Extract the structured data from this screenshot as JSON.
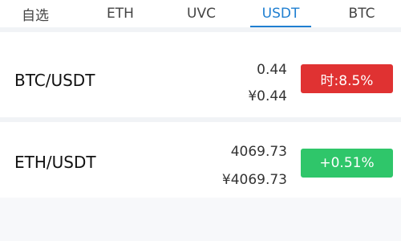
{
  "tabs": [
    {
      "label": "自选"
    },
    {
      "label": "ETH"
    },
    {
      "label": "UVC"
    },
    {
      "label": "USDT",
      "active": true
    },
    {
      "label": "BTC"
    }
  ],
  "rows": [
    {
      "pair": "BTC/USDT",
      "price": "0.44",
      "price_cny": "¥0.44",
      "change": "时:8.5%",
      "change_color": "#e03232"
    },
    {
      "pair": "ETH/USDT",
      "price": "4069.73",
      "price_cny": "¥4069.73",
      "change": "+0.51%",
      "change_color": "#2fc66a"
    }
  ],
  "colors": {
    "accent": "#1f7fd1",
    "down": "#e03232",
    "up": "#2fc66a"
  }
}
